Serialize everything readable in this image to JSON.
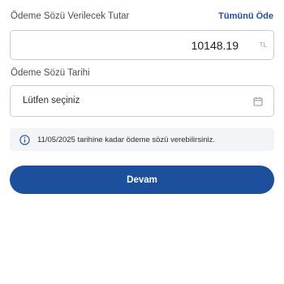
{
  "amount_section": {
    "label": "Ödeme Sözü Verilecek Tutar",
    "pay_all_link": "Tümünü Öde",
    "value": "10148.19",
    "currency": "TL"
  },
  "date_section": {
    "label": "Ödeme Sözü Tarihi",
    "placeholder": "Lütfen seçiniz",
    "icon": "calendar-icon"
  },
  "info": {
    "icon": "info-icon",
    "text": "11/05/2025 tarihine kadar ödeme sözü verebilirsiniz."
  },
  "continue_button": {
    "label": "Devam",
    "color": "#1c4f9c"
  }
}
